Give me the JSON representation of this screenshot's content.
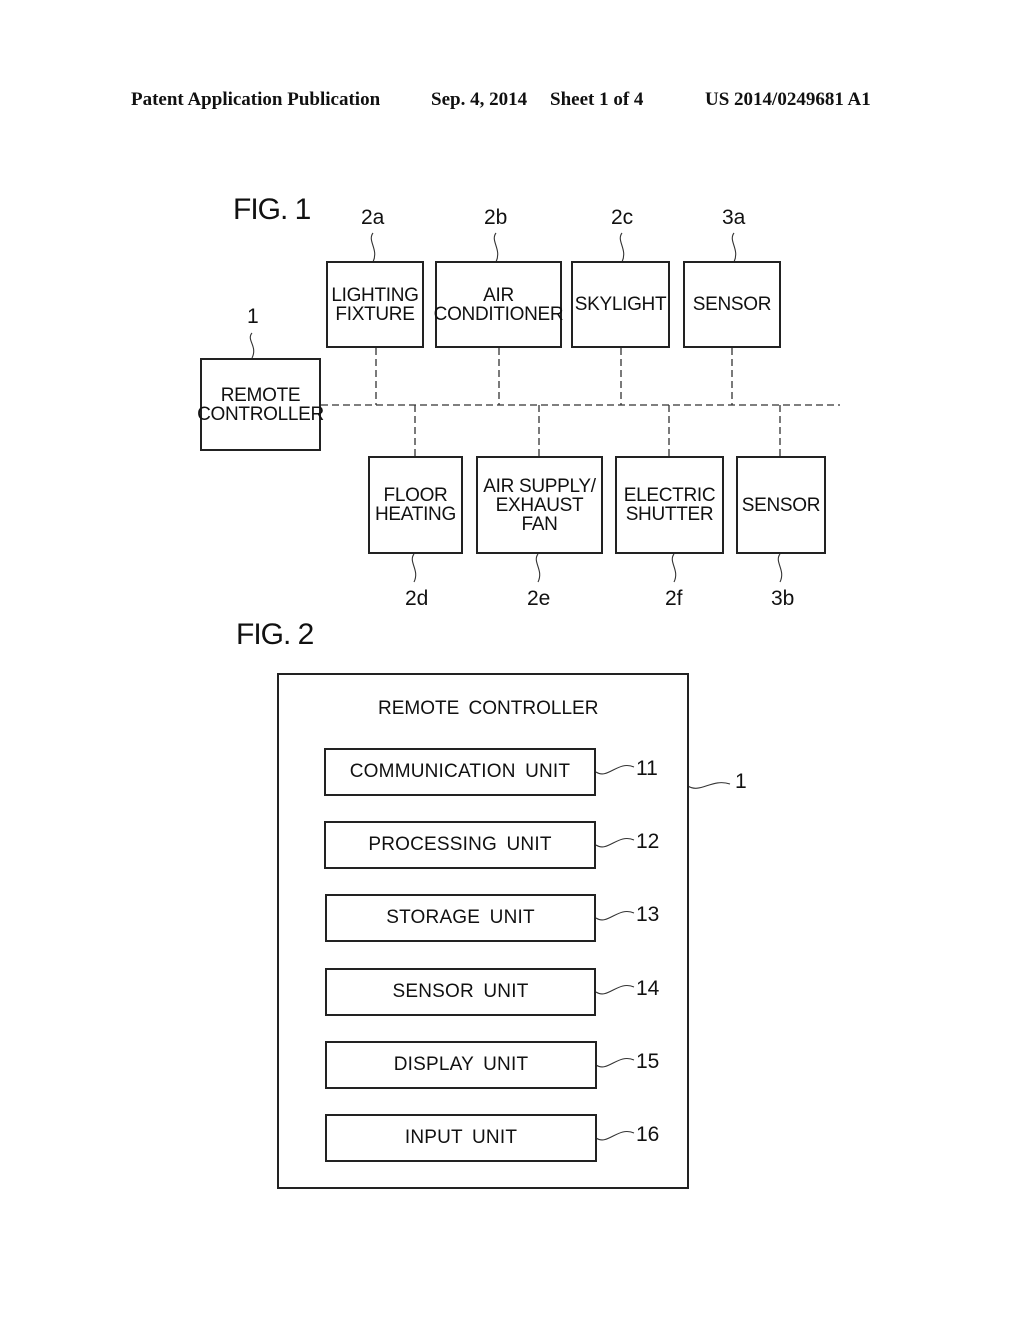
{
  "header": {
    "publication": "Patent Application Publication",
    "date": "Sep. 4, 2014",
    "sheet": "Sheet 1 of 4",
    "number": "US 2014/0249681 A1"
  },
  "fig1": {
    "label": "FIG. 1",
    "remote": {
      "label": "REMOTE\nCONTROLLER",
      "ref": "1"
    },
    "top_devices": [
      {
        "label": "LIGHTING\nFIXTURE",
        "ref": "2a"
      },
      {
        "label": "AIR\nCONDITIONER",
        "ref": "2b"
      },
      {
        "label": "SKYLIGHT",
        "ref": "2c"
      },
      {
        "label": "SENSOR",
        "ref": "3a"
      }
    ],
    "bottom_devices": [
      {
        "label": "FLOOR\nHEATING",
        "ref": "2d"
      },
      {
        "label": "AIR SUPPLY/\nEXHAUST FAN",
        "ref": "2e"
      },
      {
        "label": "ELECTRIC\nSHUTTER",
        "ref": "2f"
      },
      {
        "label": "SENSOR",
        "ref": "3b"
      }
    ]
  },
  "fig2": {
    "label": "FIG. 2",
    "title": "REMOTE CONTROLLER",
    "ref": "1",
    "units": [
      {
        "label": "COMMUNICATION UNIT",
        "ref": "11"
      },
      {
        "label": "PROCESSING UNIT",
        "ref": "12"
      },
      {
        "label": "STORAGE UNIT",
        "ref": "13"
      },
      {
        "label": "SENSOR UNIT",
        "ref": "14"
      },
      {
        "label": "DISPLAY UNIT",
        "ref": "15"
      },
      {
        "label": "INPUT UNIT",
        "ref": "16"
      }
    ]
  }
}
